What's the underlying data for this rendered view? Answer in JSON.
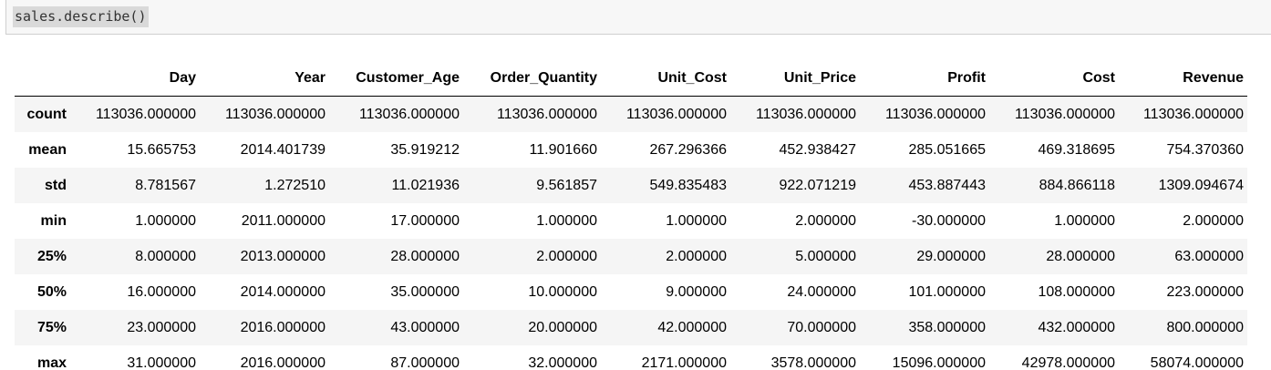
{
  "input_cell": {
    "code": "sales.describe()"
  },
  "table": {
    "index_header": "",
    "columns": [
      "Day",
      "Year",
      "Customer_Age",
      "Order_Quantity",
      "Unit_Cost",
      "Unit_Price",
      "Profit",
      "Cost",
      "Revenue"
    ],
    "rows": [
      {
        "label": "count",
        "values": [
          "113036.000000",
          "113036.000000",
          "113036.000000",
          "113036.000000",
          "113036.000000",
          "113036.000000",
          "113036.000000",
          "113036.000000",
          "113036.000000"
        ]
      },
      {
        "label": "mean",
        "values": [
          "15.665753",
          "2014.401739",
          "35.919212",
          "11.901660",
          "267.296366",
          "452.938427",
          "285.051665",
          "469.318695",
          "754.370360"
        ]
      },
      {
        "label": "std",
        "values": [
          "8.781567",
          "1.272510",
          "11.021936",
          "9.561857",
          "549.835483",
          "922.071219",
          "453.887443",
          "884.866118",
          "1309.094674"
        ]
      },
      {
        "label": "min",
        "values": [
          "1.000000",
          "2011.000000",
          "17.000000",
          "1.000000",
          "1.000000",
          "2.000000",
          "-30.000000",
          "1.000000",
          "2.000000"
        ]
      },
      {
        "label": "25%",
        "values": [
          "8.000000",
          "2013.000000",
          "28.000000",
          "2.000000",
          "2.000000",
          "5.000000",
          "29.000000",
          "28.000000",
          "63.000000"
        ]
      },
      {
        "label": "50%",
        "values": [
          "16.000000",
          "2014.000000",
          "35.000000",
          "10.000000",
          "9.000000",
          "24.000000",
          "101.000000",
          "108.000000",
          "223.000000"
        ]
      },
      {
        "label": "75%",
        "values": [
          "23.000000",
          "2016.000000",
          "43.000000",
          "20.000000",
          "42.000000",
          "70.000000",
          "358.000000",
          "432.000000",
          "800.000000"
        ]
      },
      {
        "label": "max",
        "values": [
          "31.000000",
          "2016.000000",
          "87.000000",
          "32.000000",
          "2171.000000",
          "3578.000000",
          "15096.000000",
          "42978.000000",
          "58074.000000"
        ]
      }
    ]
  }
}
